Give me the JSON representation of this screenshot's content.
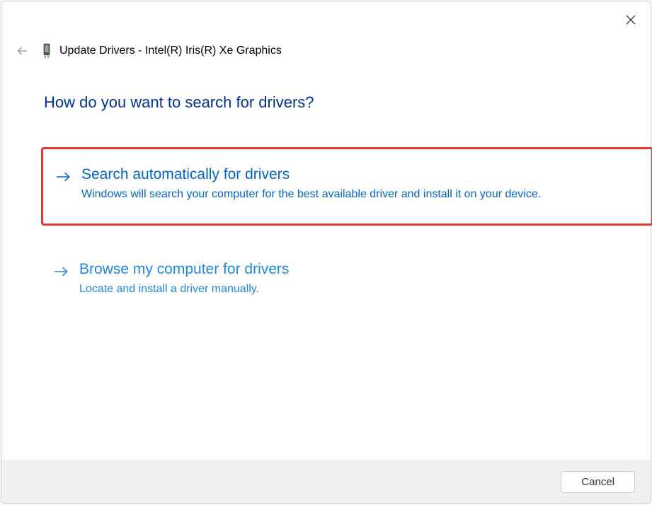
{
  "header": {
    "title": "Update Drivers - Intel(R) Iris(R) Xe Graphics"
  },
  "main": {
    "heading": "How do you want to search for drivers?"
  },
  "options": [
    {
      "title": "Search automatically for drivers",
      "description": "Windows will search your computer for the best available driver and install it on your device."
    },
    {
      "title": "Browse my computer for drivers",
      "description": "Locate and install a driver manually."
    }
  ],
  "footer": {
    "cancel_label": "Cancel"
  }
}
